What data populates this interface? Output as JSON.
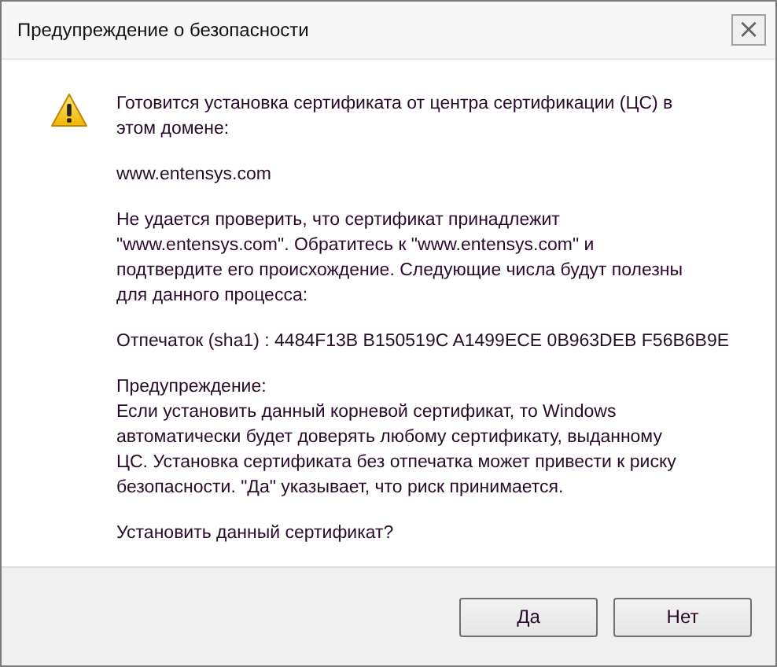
{
  "window": {
    "title": "Предупреждение о безопасности",
    "close": "×"
  },
  "message": {
    "paragraphs": [
      {
        "lines": [
          "Готовится установка сертификата от центра сертификации (ЦС) в",
          "этом домене:"
        ]
      },
      {
        "lines": [
          "www.entensys.com"
        ]
      },
      {
        "lines": [
          "Не удается проверить, что сертификат принадлежит",
          "\"www.entensys.com\". Обратитесь к \"www.entensys.com\" и",
          "подтвердите его происхождение. Следующие числа будут полезны",
          "для данного процесса:"
        ]
      },
      {
        "lines": [
          "Отпечаток (sha1) : 4484F13B B150519C A1499ECE 0B963DEB F56B6B9E"
        ]
      },
      {
        "lines": [
          "Предупреждение:",
          "Если установить данный корневой сертификат, то Windows",
          "автоматически будет доверять любому сертификату, выданному",
          "ЦС. Установка сертификата без отпечатка может привести к риску",
          "безопасности. \"Да\" указывает, что риск принимается."
        ]
      },
      {
        "lines": [
          "Установить данный сертификат?"
        ]
      }
    ]
  },
  "buttons": [
    {
      "label": "Да"
    },
    {
      "label": "Нет"
    }
  ]
}
